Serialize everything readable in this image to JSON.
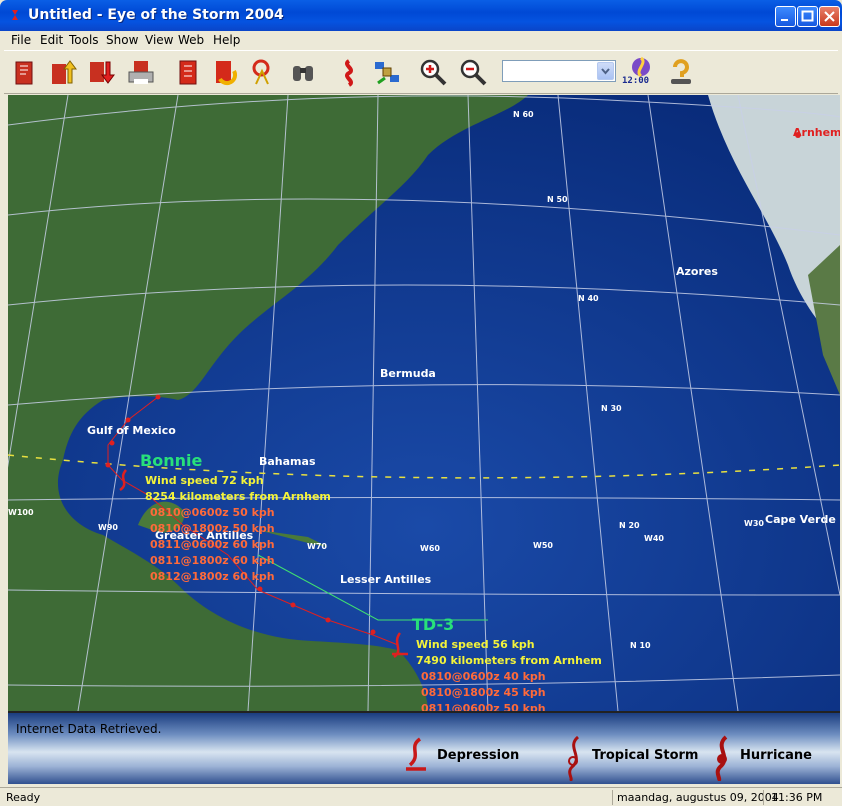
{
  "window": {
    "title": "Untitled - Eye of the Storm 2004"
  },
  "menu": [
    "File",
    "Edit",
    "Tools",
    "Show",
    "View",
    "Web",
    "Help"
  ],
  "toolbar": {
    "clock": "12:00",
    "combo_value": "",
    "tools": [
      "open-storm-icon",
      "import-icon",
      "export-icon",
      "print-icon",
      "storm-file-icon",
      "refresh-icon",
      "distance-icon",
      "binoculars-icon",
      "hurricane-icon",
      "satellite-icon",
      "zoom-in-icon",
      "zoom-out-icon",
      "clock-storm-icon",
      "help-icon"
    ]
  },
  "map": {
    "places": [
      "Azores",
      "Bermuda",
      "Gulf of Mexico",
      "Bahamas",
      "Greater Antilles",
      "Lesser Antilles",
      "Cape Verde",
      "Arnhem"
    ],
    "gridlabels": [
      "N 60",
      "N 50",
      "N 40",
      "N 30",
      "N 20",
      "N 10",
      "W100",
      "W90",
      "W70",
      "W60",
      "W50",
      "W40",
      "W30"
    ],
    "storms": [
      {
        "name": "Bonnie",
        "wind": "Wind speed 72 kph",
        "distance": "8254 kilometers from Arnhem",
        "forecasts": [
          "0810@0600z 50 kph",
          "0810@1800z 50 kph",
          "0811@0600z 60 kph",
          "0811@1800z 60 kph",
          "0812@1800z 60 kph"
        ]
      },
      {
        "name": "TD-3",
        "wind": "Wind speed 56 kph",
        "distance": "7490 kilometers from Arnhem",
        "forecasts": [
          "0810@0600z 40 kph",
          "0810@1800z 45 kph",
          "0811@0600z 50 kph"
        ]
      }
    ]
  },
  "legend": {
    "message": "Internet Data Retrieved.",
    "items": [
      "Depression",
      "Tropical Storm",
      "Hurricane"
    ]
  },
  "status": {
    "text": "Ready",
    "date": "maandag, augustus 09, 2004",
    "time": "11:36 PM"
  },
  "colors": {
    "titlebar": "#0049d5",
    "ocean": "#0a2f8a",
    "storm_label": "#28e07a",
    "wind_text": "#f3f33a",
    "forecast_text": "#ff6a3a"
  }
}
